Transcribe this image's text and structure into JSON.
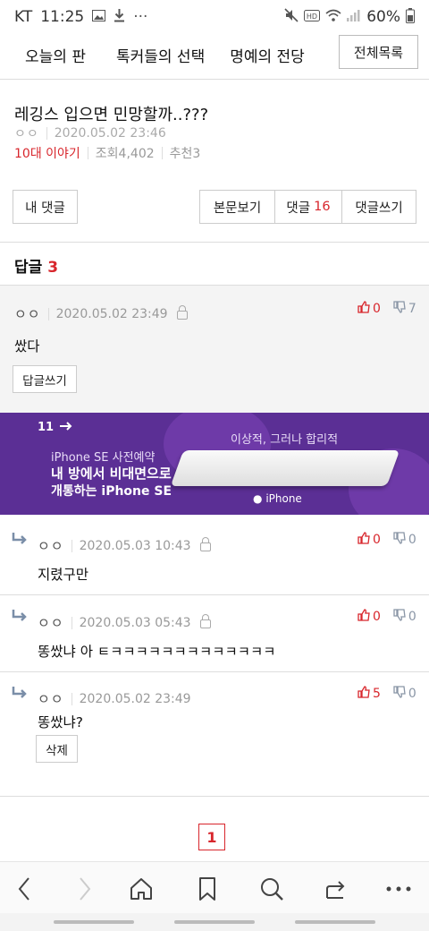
{
  "status_bar": {
    "carrier": "KT",
    "time": "11:25",
    "battery": "60%",
    "dots": "···"
  },
  "nav": {
    "items": [
      "오늘의 판",
      "톡커들의 선택",
      "명예의 전당"
    ],
    "all_list": "전체목록"
  },
  "post": {
    "title": "레깅스 입으면 민망할까..???",
    "author": "ㅇㅇ",
    "datetime": "2020.05.02 23:46",
    "category": "10대 이야기",
    "views": "조회4,402",
    "recommend": "추천3"
  },
  "actions": {
    "my_comments": "내 댓글",
    "view_body": "본문보기",
    "comments_label": "댓글",
    "comments_count": "16",
    "write_comment": "댓글쓰기"
  },
  "replies": {
    "label": "답글",
    "count": "3"
  },
  "parent_comment": {
    "author": "ㅇㅇ",
    "datetime": "2020.05.02 23:49",
    "up": "0",
    "down": "7",
    "text": "쌌다",
    "reply_button": "답글쓰기"
  },
  "ad": {
    "brand": "11",
    "line1": "iPhone SE 사전예약",
    "line2": "내 방에서 비대면으로",
    "line3": "개통하는 iPhone SE",
    "tagline": "이상적, 그러나 합리적",
    "product": "iPhone"
  },
  "reply_list": [
    {
      "author": "ㅇㅇ",
      "datetime": "2020.05.03 10:43",
      "up": "0",
      "down": "0",
      "text": "지렸구만"
    },
    {
      "author": "ㅇㅇ",
      "datetime": "2020.05.03 05:43",
      "up": "0",
      "down": "0",
      "text": "똥쌌냐 아 ㅌㅋㅋㅋㅋㅋㅋㅋㅋㅋㅋㅋㅋㅋ"
    },
    {
      "author": "ㅇㅇ",
      "datetime": "2020.05.02 23:49",
      "up": "5",
      "down": "0",
      "text": "똥쌌냐?",
      "delete_button": "삭제"
    }
  ],
  "pagination": {
    "current": "1"
  },
  "browser_bar": {
    "icons": [
      "back-icon",
      "forward-icon",
      "home-icon",
      "bookmark-icon",
      "search-icon",
      "share-icon",
      "more-icon"
    ]
  }
}
